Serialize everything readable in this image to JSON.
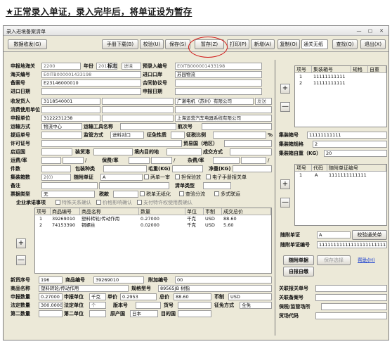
{
  "heading": "★正常录入单证，录入完毕后，将单证设为暂存",
  "window": {
    "title": "录入进境备案清单",
    "min": "—",
    "max": "▢",
    "close": "✕"
  },
  "toolbar": {
    "data_exchange": "数据收发(G)",
    "manual_download": "手册下载(B)",
    "verify": "校验(U)",
    "save": "保存(S)",
    "temp_save": "暂存(Z)",
    "print": "打印(P)",
    "add": "新增(A)",
    "copy": "复制(O)",
    "clearance_dropdown": "通关无纸",
    "find": "查找(Q)",
    "exit": "退出(X)"
  },
  "form": {
    "r1": {
      "declare_port_label": "申报地海关",
      "declare_port": "2200",
      "year_label": "年份",
      "year": "2017",
      "flag_label": "标志",
      "flag": "进境",
      "pre_entry_label": "预录入编号",
      "pre_entry": "E0ITB000001433198"
    },
    "r2": {
      "customs_no_label": "海关编号",
      "customs_no": "E0ITB000001433198",
      "import_port_label": "进口口岸",
      "import_port": "苏园物流"
    },
    "r3": {
      "record_no_label": "备案号",
      "record_no": "E23146000010",
      "contract_label": "合同协议号"
    },
    "r4": {
      "import_date_label": "进口日期",
      "declare_date_label": "申报日期"
    },
    "r5": {
      "consignee_label": "收发货人",
      "consignee_code": "3118540001",
      "consignee_name": "广濑电机（苏州）有限公司",
      "consignee_flag": "发送"
    },
    "r6": {
      "consumer_label": "消费使用单位"
    },
    "r7": {
      "declarant_label": "申报单位",
      "declarant_code": "3122231238",
      "declarant_name": "上海运营汽车电器系统有限公司"
    },
    "r8": {
      "transport_mode_label": "运输方式",
      "transport_mode": "物流中心",
      "vehicle_label": "运输工具名称",
      "voyage_label": "航次号"
    },
    "r9": {
      "bill_no_label": "提运单号",
      "supervision_label": "监管方式",
      "supervision": "进料对口",
      "tax_nature_label": "征免性质",
      "tax_ratio_label": "征税比例",
      "pct": "%"
    },
    "r10": {
      "license_label": "许可证号",
      "trade_country_label": "贸易国（地区）"
    },
    "r11": {
      "origin_country_label": "启运国",
      "loading_port_label": "装货港",
      "domestic_dest_label": "境内目的地",
      "deal_mode_label": "成交方式"
    },
    "r12": {
      "freight_label": "运费/率",
      "slash1": "/",
      "insurance_label": "保费/率",
      "slash2": "/",
      "misc_label": "杂费/率",
      "slash3": "/"
    },
    "r13": {
      "packages_label": "件数",
      "pack_type_label": "包装种类",
      "gross_label": "毛重(KG)",
      "net_label": "净重(KG)"
    },
    "r14": {
      "container_count_label": "集装箱数",
      "container_count": "2(0)",
      "docs_label": "随附单证",
      "docs": "A",
      "two_in_one": "两单一审",
      "guarantee": "担保验放",
      "e_manual": "电子手册报关单"
    },
    "r15": {
      "remark_label": "备注",
      "list_type_label": "清单类型"
    },
    "r16": {
      "note_type_label": "票据类型",
      "note_type": "无",
      "tax_label": "税款",
      "tax_ticket": "税单无纸化",
      "inspect": "查验分流",
      "multi": "多式联运"
    },
    "r17": {
      "commitment_label": "企业承诺事项",
      "c1": "特殊关系确认",
      "c2": "价格影响确认",
      "c3": "支付特许权使用费确认"
    }
  },
  "goods_table": {
    "add": "+",
    "remove": "—",
    "headers": [
      "项号",
      "商品编号",
      "商品名称",
      "数量",
      "单位",
      "币制",
      "成交总价"
    ],
    "rows": [
      [
        "1",
        "39269010",
        "塑料转轮/传动作用",
        "0.27000",
        "千克",
        "USD",
        "88.60"
      ],
      [
        "2",
        "74153390",
        "铜螺丝",
        "0.02000",
        "千克",
        "USD",
        "5.60"
      ]
    ]
  },
  "goods_detail": {
    "item_label": "新货序号",
    "item": "196",
    "code_label": "商品编号",
    "code": "39269010",
    "extra_label": "附加编号",
    "extra": "00",
    "name_label": "商品名称",
    "name": "塑料转轮/传动作用",
    "spec_label": "规格型号",
    "spec": "89565JB 树脂",
    "qty_label": "申报数量",
    "qty": "0.27000",
    "unit_label": "申报单位",
    "unit": "千克",
    "price_label": "单价",
    "price": "0.2953",
    "total_label": "总价",
    "total": "88.60",
    "currency_label": "币制",
    "currency": "USD",
    "legal_qty_label": "法定数量",
    "legal_qty": "300.00000",
    "legal_unit_label": "法定单位",
    "legal_unit": "个",
    "version_label": "版本号",
    "goods_no_label": "货号",
    "exempt_label": "征免方式",
    "exempt": "全免",
    "second_qty_label": "第二数量",
    "second_unit_label": "第二单位",
    "origin_label": "原产国",
    "origin": "日本",
    "dest_label": "目的国"
  },
  "container_table": {
    "add": "+",
    "remove": "—",
    "headers": [
      "项号",
      "集装箱号",
      "规格",
      "自重"
    ],
    "rows": [
      [
        "1",
        "11111111111",
        "",
        ""
      ],
      [
        "2",
        "11111111111",
        "",
        ""
      ]
    ],
    "no_label": "集装箱号",
    "no": "11111111111",
    "spec_label": "集装箱规格",
    "spec": "2",
    "weight_label": "集装箱自重（KG）",
    "weight": "20"
  },
  "docs_table": {
    "add": "+",
    "remove": "—",
    "headers": [
      "项号",
      "代码",
      "随附单证编号"
    ],
    "rows": [
      [
        "1",
        "A",
        "1111111111111"
      ]
    ],
    "code_label": "随附单证",
    "code": "A",
    "verify_btn": "校验通关单",
    "no_label": "随附单证编号",
    "no": "1111111111111111111111111",
    "docs_btn": "随附单据",
    "save_as": "保存选择",
    "help": "帮助(H)",
    "self_report": "自报自缴"
  },
  "right_bottom": {
    "r1_label": "关联报关单号",
    "r2_label": "关联备案号",
    "r3_label": "保税/监管场所",
    "r4_label": "货场代码"
  }
}
